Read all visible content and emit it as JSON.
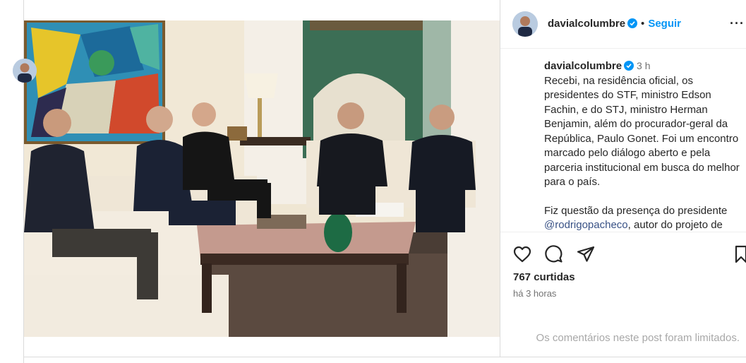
{
  "post": {
    "username": "davialcolumbre",
    "follow_label": "Seguir",
    "separator": "•",
    "more_label": "···",
    "time_ago": "3 h",
    "caption_p1": "Recebi, na residência oficial, os presidentes do STF, ministro Edson Fachin, e do STJ, ministro Herman Benjamin, além do procurador-geral da República, Paulo Gonet. Foi um encontro marcado pelo diálogo aberto e pela parceria institucional em busca do melhor para o país.",
    "caption_p2_start": "Fiz questão da presença do presidente ",
    "caption_mention": "@rodrigopacheco",
    "caption_p2_end": ", autor do projeto de",
    "likes": "767 curtidas",
    "posted": "há 3 horas",
    "comments_limited": "Os comentários neste post foram limitados."
  },
  "icons": {
    "verified": "verified-badge-icon",
    "like": "heart-icon",
    "comment": "comment-icon",
    "share": "paper-plane-icon",
    "save": "bookmark-icon"
  },
  "colors": {
    "link": "#0095f6",
    "verified": "#0095f6",
    "muted": "#737373",
    "mention": "#385185"
  }
}
